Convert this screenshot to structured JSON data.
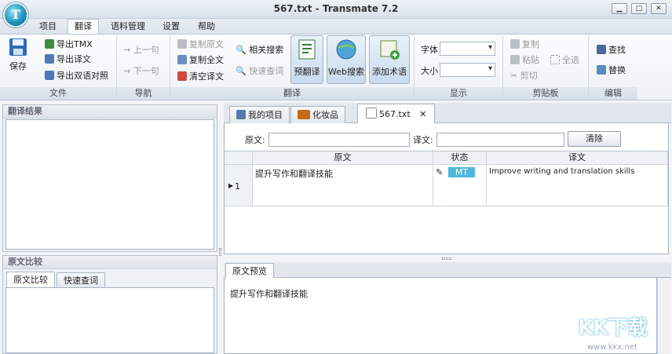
{
  "window": {
    "title": "567.txt - Transmate 7.2",
    "logo_letter": "T"
  },
  "window_controls": {
    "minimize": "▁",
    "restore": "□",
    "close": "✕"
  },
  "menu": [
    "项目",
    "翻译",
    "语料管理",
    "设置",
    "帮助"
  ],
  "ribbon": {
    "file": {
      "save": "保存",
      "export_tmx": "导出TMX",
      "export_translation": "导出译文",
      "export_bilingual": "导出双语对照",
      "label": "文件"
    },
    "nav": {
      "prev": "上一句",
      "next": "下一句",
      "label": "导航"
    },
    "translate": {
      "copy_source": "复制原文",
      "copy_all": "复制全文",
      "clear_target": "清空译文",
      "related_search": "相关搜索",
      "quick_lookup": "快速查词",
      "pretranslate": "预翻译",
      "web_search": "Web搜索",
      "add_term": "添加术语",
      "label": "翻译"
    },
    "display": {
      "font": "字体",
      "size": "大小",
      "label": "显示"
    },
    "clipboard": {
      "copy": "复制",
      "paste": "粘贴",
      "select_all": "全选",
      "cut": "剪切",
      "label": "剪贴板"
    },
    "edit": {
      "find": "查找",
      "replace": "替换",
      "label": "编辑"
    }
  },
  "left": {
    "result_title": "翻译结果",
    "compare_title": "原文比较",
    "tabs": [
      "原文比较",
      "快速查词"
    ]
  },
  "doc_tabs": [
    "我的项目",
    "化妆品",
    "567.txt"
  ],
  "filter": {
    "source_label": "原文:",
    "target_label": "译文:",
    "clear": "清除"
  },
  "grid": {
    "headers": [
      "原文",
      "状态",
      "译文"
    ],
    "rows": [
      {
        "index": "1",
        "source": "提升写作和翻译技能",
        "status": "MT",
        "target": "Improve writing and translation skills"
      }
    ]
  },
  "preview": {
    "tab": "原文预览",
    "text": "提升写作和翻译技能"
  },
  "watermark": {
    "brand": "KK下载",
    "url": "www.kkx.net"
  },
  "colors": {
    "accent": "#1a8fb9",
    "status_mt": "#4fb7d9"
  }
}
